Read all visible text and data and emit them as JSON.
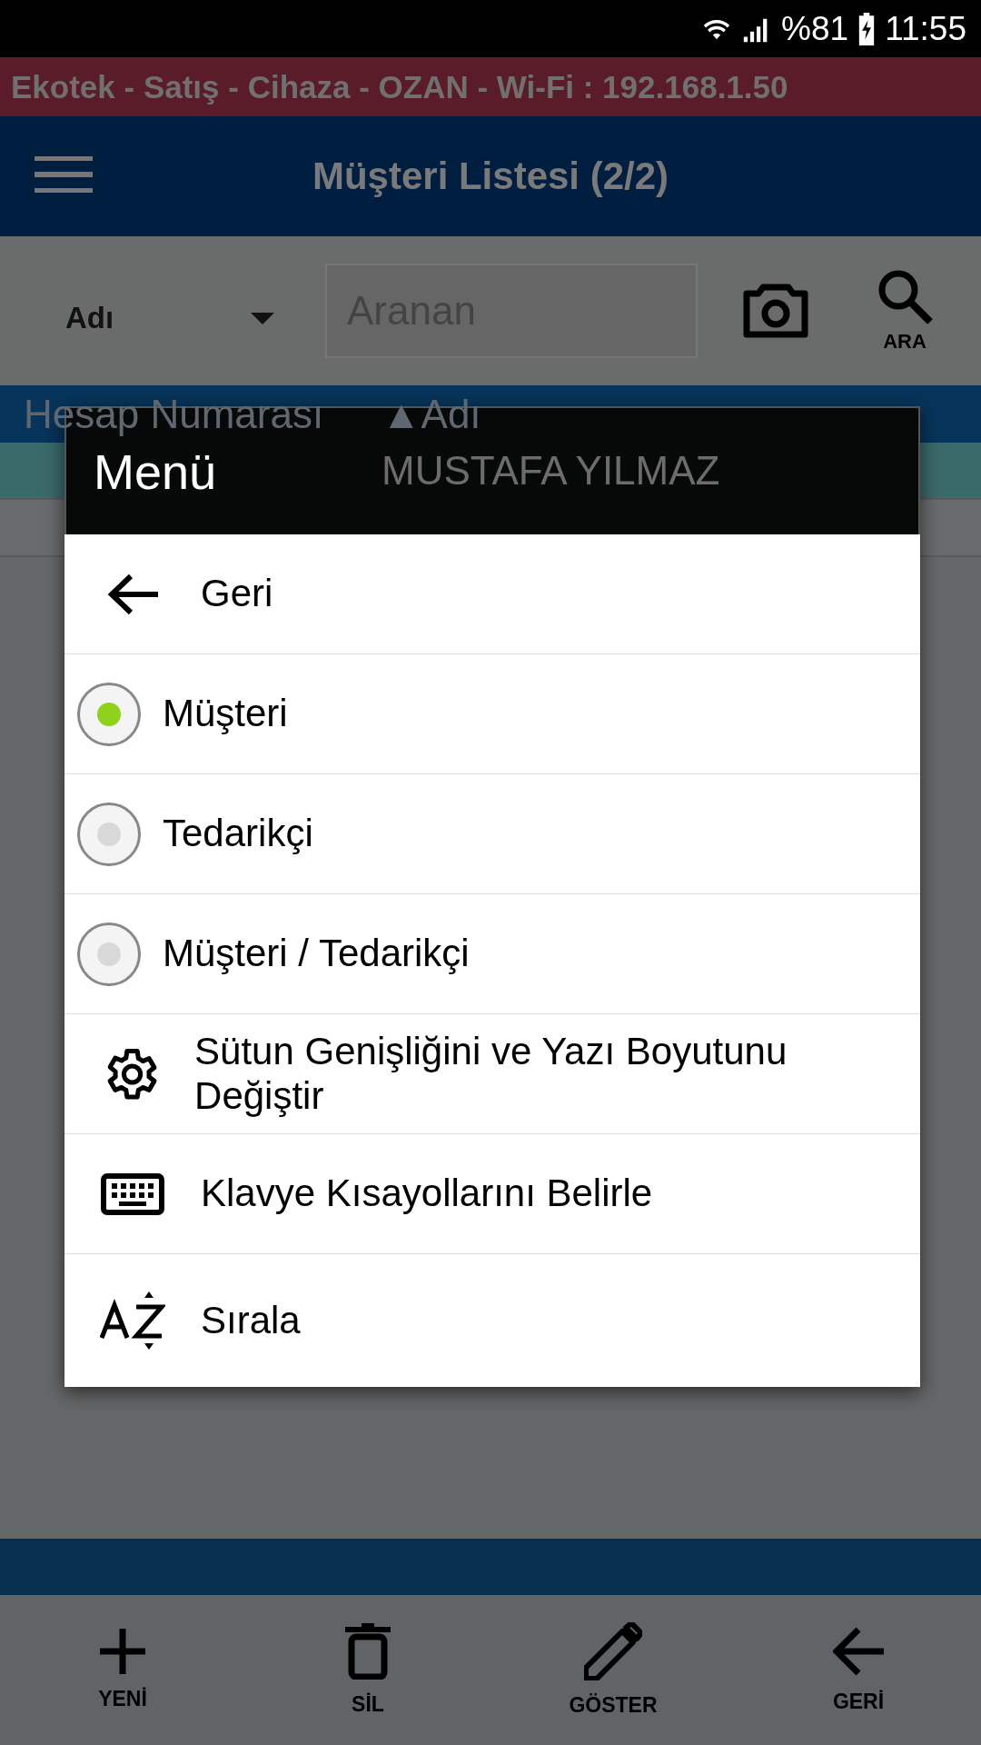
{
  "status_bar": {
    "battery": "%81",
    "time": "11:55"
  },
  "banner": {
    "text": "Ekotek - Satış - Cihaza - OZAN - Wi-Fi : 192.168.1.50"
  },
  "app_bar": {
    "title": "Müşteri Listesi (2/2)"
  },
  "search": {
    "field": "Adı",
    "placeholder": "Aranan",
    "button": "ARA"
  },
  "table": {
    "columns": [
      "Hesap Numarası",
      "▲Adı"
    ],
    "rows": [
      {
        "name": "MUSTAFA YILMAZ",
        "selected": true
      },
      {
        "selected": false
      }
    ]
  },
  "dialog": {
    "title": "Menü",
    "items": [
      {
        "kind": "back",
        "label": "Geri"
      },
      {
        "kind": "radio",
        "label": "Müşteri",
        "selected": true
      },
      {
        "kind": "radio",
        "label": "Tedarikçi",
        "selected": false
      },
      {
        "kind": "radio",
        "label": "Müşteri / Tedarikçi",
        "selected": false
      },
      {
        "kind": "settings",
        "label": "Sütun Genişliğini ve Yazı Boyutunu Değiştir"
      },
      {
        "kind": "keyboard",
        "label": "Klavye Kısayollarını Belirle"
      },
      {
        "kind": "sort",
        "label": "Sırala"
      }
    ]
  },
  "bottom_nav": [
    {
      "kind": "add",
      "label": "YENİ"
    },
    {
      "kind": "delete",
      "label": "SİL"
    },
    {
      "kind": "edit",
      "label": "GÖSTER"
    },
    {
      "kind": "back",
      "label": "GERİ"
    }
  ]
}
